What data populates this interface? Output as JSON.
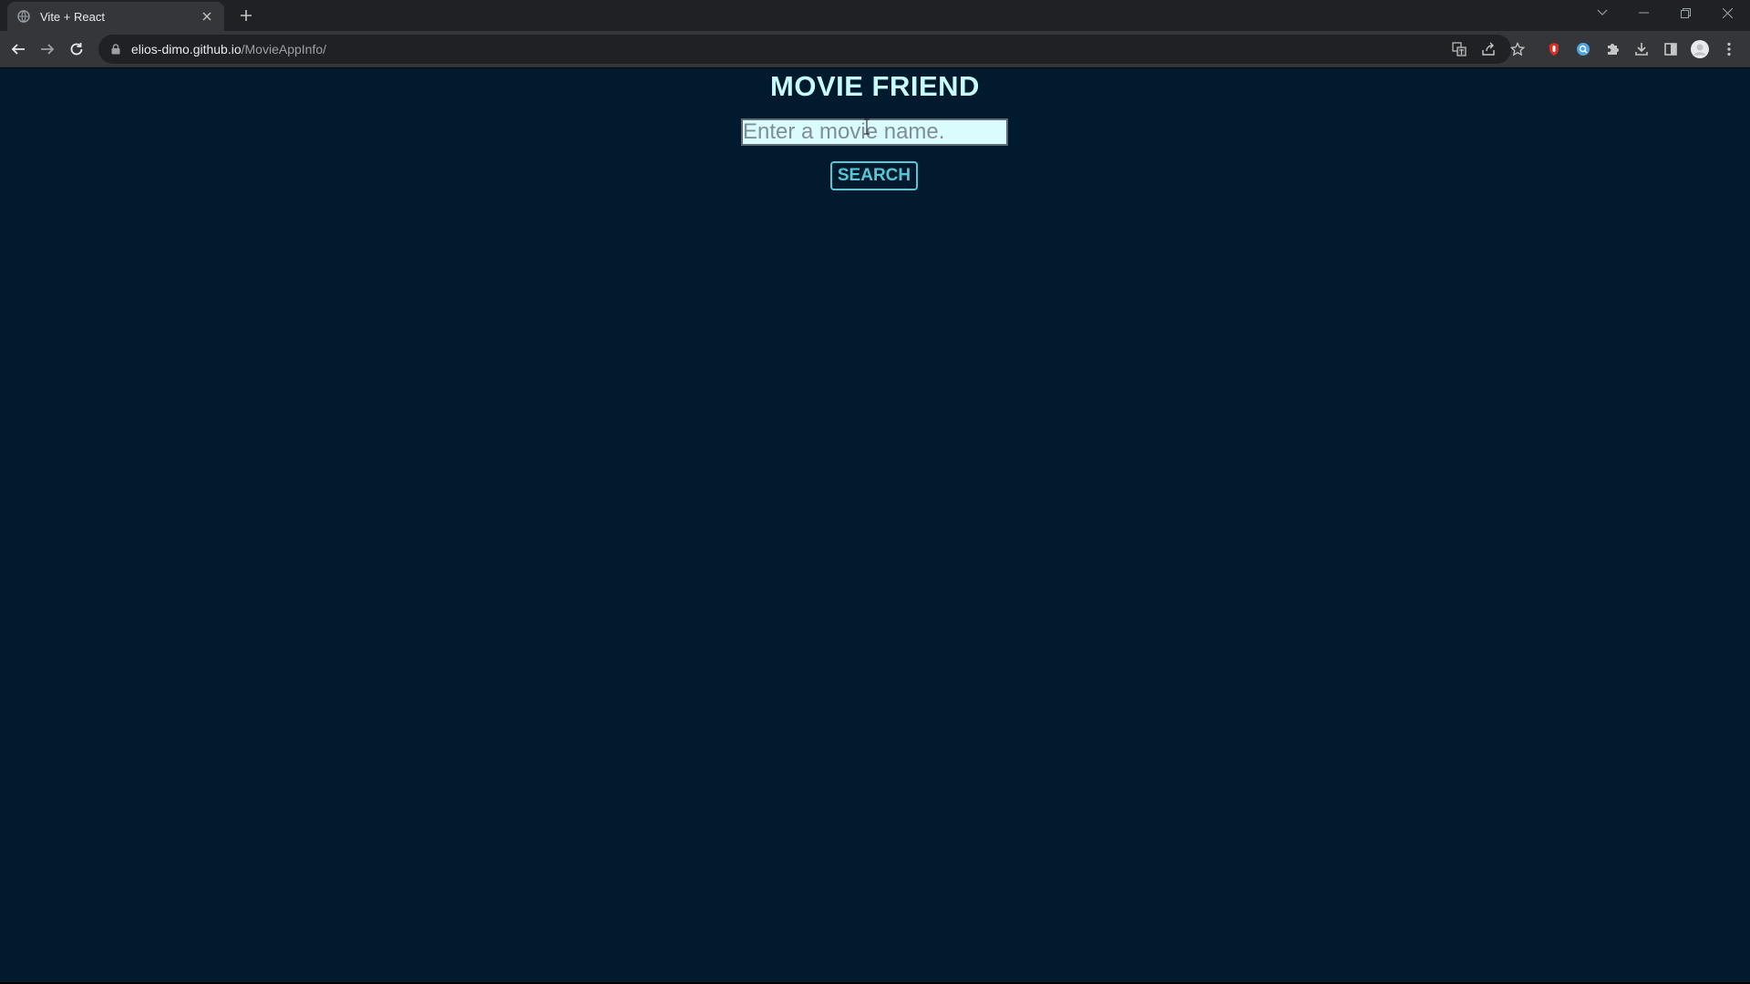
{
  "browser": {
    "tab_title": "Vite + React",
    "url_host": "elios-dimo.github.io",
    "url_path": "/MovieAppInfo/",
    "icons": {
      "favicon": "globe-icon",
      "close": "close-icon",
      "new_tab": "plus-icon",
      "back": "arrow-left-icon",
      "forward": "arrow-right-icon",
      "reload": "reload-icon",
      "lock": "lock-icon",
      "translate": "translate-icon",
      "share": "share-icon",
      "bookmark": "star-icon",
      "extension_red": "extension-red-icon",
      "extension_blue": "extension-blue-icon",
      "extensions": "puzzle-icon",
      "download": "download-icon",
      "side_panel": "side-panel-icon",
      "profile": "avatar",
      "menu": "kebab-menu-icon"
    }
  },
  "page": {
    "title": "MOVIE FRIEND",
    "search_placeholder": "Enter a movie name.",
    "search_value": "",
    "search_button": "SEARCH",
    "colors": {
      "background": "#011a2e",
      "title": "#c8fbff",
      "input_bg": "#dafcfd",
      "accent": "#56c7d4"
    }
  }
}
